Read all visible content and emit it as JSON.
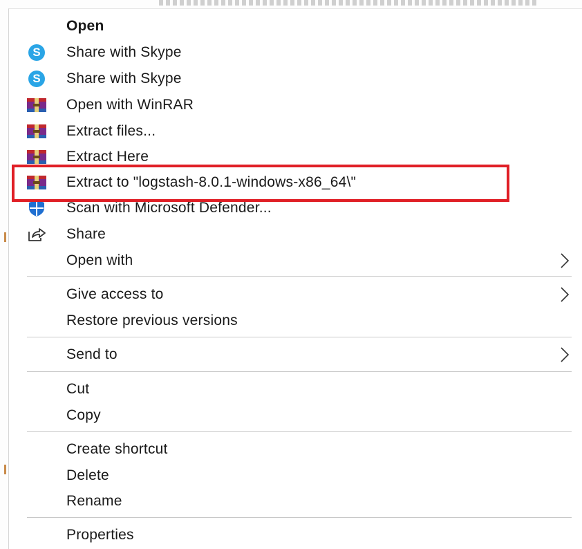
{
  "menu": {
    "items": {
      "open": "Open",
      "share_skype_1": "Share with Skype",
      "share_skype_2": "Share with Skype",
      "open_winrar": "Open with WinRAR",
      "extract_files": "Extract files...",
      "extract_here": "Extract Here",
      "extract_to": "Extract to \"logstash-8.0.1-windows-x86_64\\\"",
      "scan_defender": "Scan with Microsoft Defender...",
      "share": "Share",
      "open_with": "Open with",
      "give_access": "Give access to",
      "restore_versions": "Restore previous versions",
      "send_to": "Send to",
      "cut": "Cut",
      "copy": "Copy",
      "create_shortcut": "Create shortcut",
      "delete": "Delete",
      "rename": "Rename",
      "properties": "Properties"
    }
  },
  "colors": {
    "highlight_border": "#e01f26",
    "skype": "#2aa5e6",
    "defender": "#1f6fd1"
  },
  "icons": {
    "skype": "skype-icon",
    "winrar": "winrar-icon",
    "defender": "defender-shield-icon",
    "share": "share-icon",
    "submenu": "chevron-right-icon"
  }
}
